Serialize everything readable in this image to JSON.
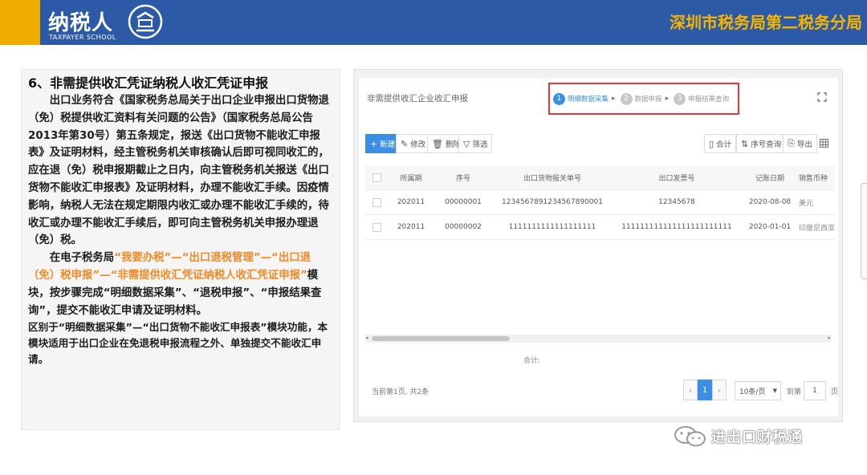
{
  "banner": {
    "logo_text": "纳税人",
    "logo_sub": "TAXPAYER SCHOOL",
    "bureau": "深圳市税务局第二税务分局",
    "colors": {
      "bar": "#2d5aa7",
      "accent": "#f0ad00",
      "bureau_text": "#f5b400"
    }
  },
  "article": {
    "heading": "6、非需提供收汇凭证纳税人收汇凭证申报",
    "para1": "出口业务符合《国家税务总局关于出口企业申报出口货物退（免）税提供收汇资料有关问题的公告》（国家税务总局公告2013年第30号）第五条规定，报送《出口货物不能收汇申报表》及证明材料，经主管税务机关审核确认后即可视同收汇的，应在退（免）税申报期截止之日内，向主管税务机关报送《出口货物不能收汇申报表》及证明材料，办理不能收汇手续。因疫情影响，纳税人无法在规定期限内收汇或办理不能收汇手续的，待收汇或办理不能收汇手续后，即可向主管税务机关申报办理退（免）税。",
    "para2_prefix": "在电子税务局",
    "para2_path": "“我要办税”—“出口退税管理”—“出口退（免）税申报”—“非需提供收汇凭证纳税人收汇凭证申报”",
    "para2_suffix": "模块，按步骤完成“明细数据采集”、“退税申报”、“申报结果查询”，提交不能收汇申请及证明材料。",
    "para3": "区别于“明细数据采集”—“出口货物不能收汇申报表”模块功能，本模块适用于出口企业在免退税申报流程之外、单独提交不能收汇申请。",
    "highlight_color": "#f08a24"
  },
  "screenshot": {
    "title": "非需提供收汇企业收汇申报",
    "steps": [
      {
        "num": "1",
        "label": "明细数据采集"
      },
      {
        "num": "2",
        "label": "数据申报"
      },
      {
        "num": "3",
        "label": "申报结果查询"
      }
    ],
    "toolbar": {
      "add": "新建",
      "edit": "修改",
      "delete": "删除",
      "filter": "筛选",
      "subtotal": "合计",
      "sequence": "序号查询",
      "export": "导出"
    },
    "columns": [
      "所属期",
      "序号",
      "出口货物报关单号",
      "出口发票号",
      "记账日期",
      "销售币种"
    ],
    "rows": [
      {
        "period": "202011",
        "seq": "00000001",
        "customs_no": "1234567891234567890001",
        "invoice_no": "12345678",
        "date": "2020-08-08",
        "currency": "美元"
      },
      {
        "period": "202011",
        "seq": "00000002",
        "customs_no": "1111111111111111111",
        "invoice_no": "111111111111111111111111",
        "date": "2020-01-01",
        "currency": "印度尼西亚卢比"
      }
    ],
    "sum_label": "合计:",
    "total_text": "当前第1页, 共2条",
    "pager": {
      "prev": "‹",
      "current": "1",
      "next": "›",
      "page_size": "10条/页",
      "goto_label": "到第",
      "goto_value": "1",
      "page_word": "页"
    },
    "accent": "#3a8ee6",
    "step_box_color": "#e53935"
  },
  "watermark": {
    "name": "进出口财税通"
  }
}
